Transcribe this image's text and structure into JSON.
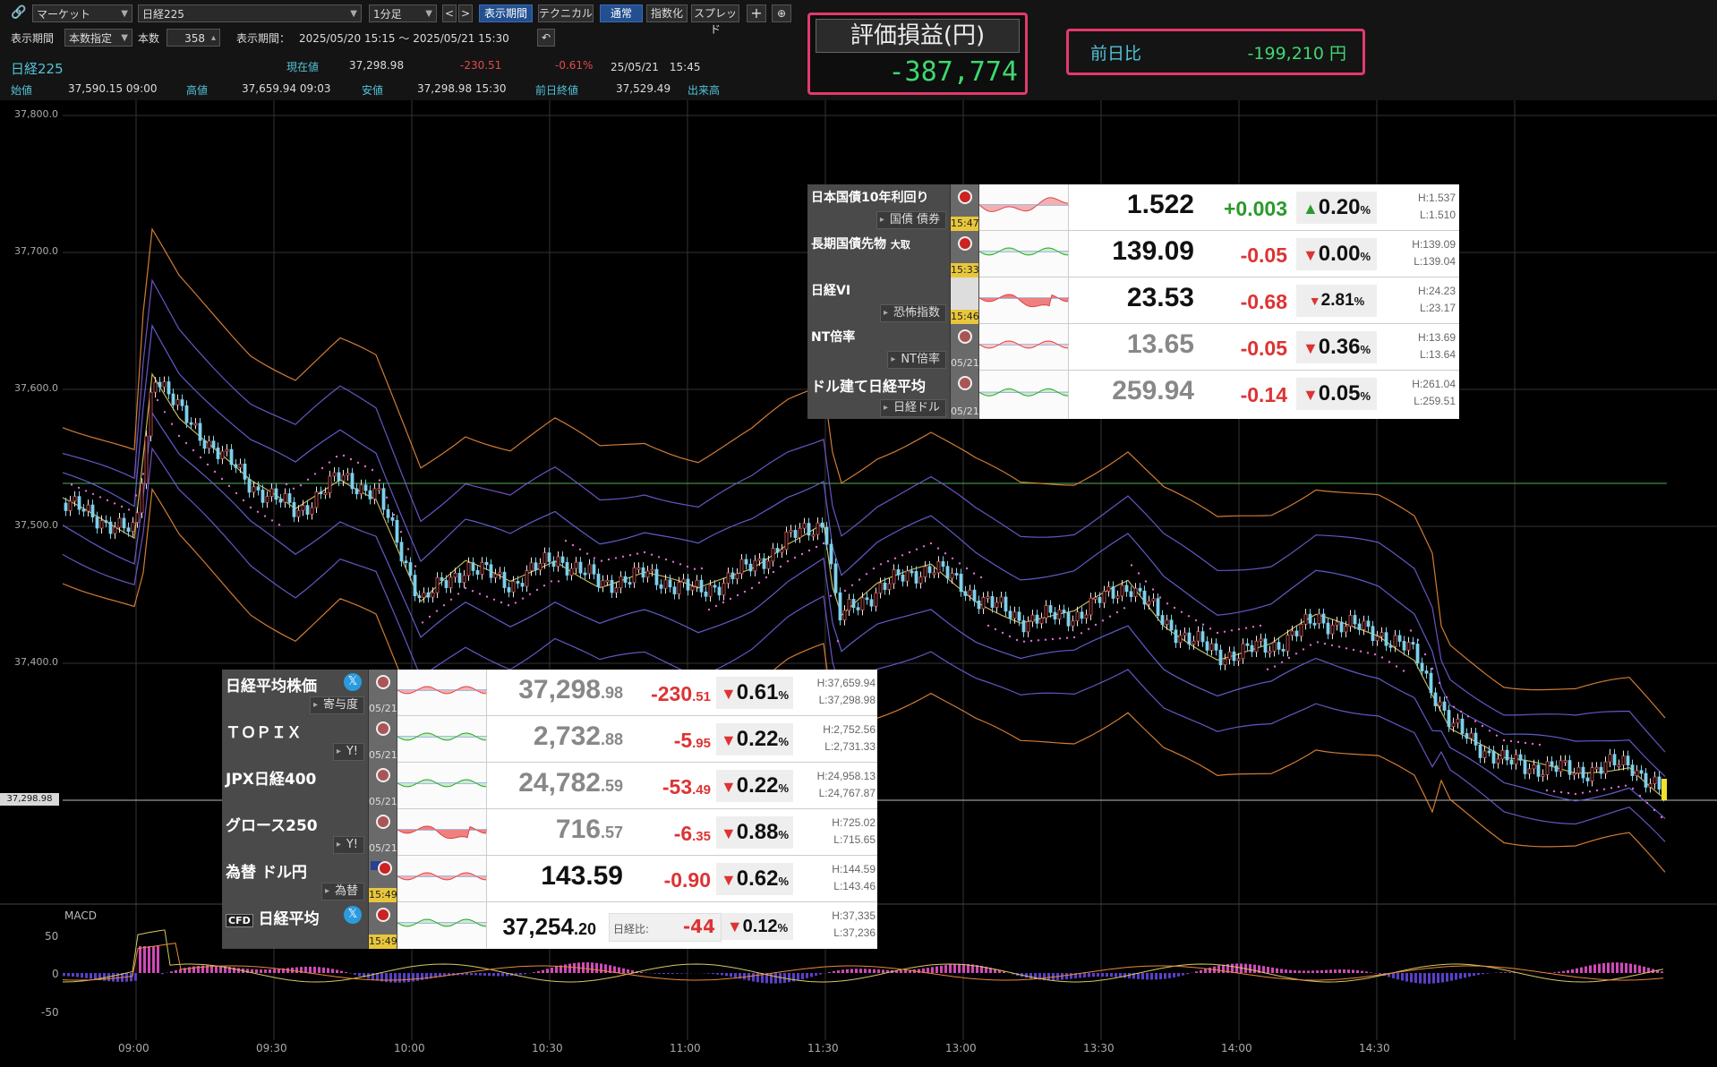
{
  "toolbar": {
    "market_select": "マーケット",
    "symbol_select": "日経225",
    "interval_select": "1分足",
    "prev_label": "<",
    "next_label": ">",
    "btn_period": "表示期間",
    "btn_technical": "テクニカル",
    "btn_normal": "通常",
    "btn_index": "指数化",
    "btn_spread": "スプレッド",
    "btn_plus": "+",
    "period_label": "表示期間",
    "period_mode": "本数指定",
    "count_label": "本数",
    "count_value": "358",
    "range_label": "表示期間：",
    "range_value": "2025/05/20 15:15 ～ 2025/05/21 15:30"
  },
  "quote": {
    "name": "日経225",
    "current_label": "現在値",
    "current_value": "37,298.98",
    "change_value": "-230.51",
    "change_pct": "-0.61%",
    "datetime": "25/05/21　15:45",
    "open_label": "始値",
    "open_value": "37,590.15  09:00",
    "high_label": "高値",
    "high_value": "37,659.94  09:03",
    "low_label": "安値",
    "low_value": "37,298.98  15:30",
    "prev_close_label": "前日終値",
    "prev_close_value": "37,529.49",
    "volume_label": "出来高"
  },
  "pl": {
    "title": "評価損益(円)",
    "value": "-387,774"
  },
  "dod": {
    "label": "前日比",
    "value": "-199,210 円"
  },
  "colors": {
    "accent_pink": "#e33a6d",
    "up_green": "#3ed870",
    "down_red": "#d33333",
    "cyan": "#53c2d8"
  },
  "chart": {
    "y_labels": [
      "37,800.0",
      "37,700.0",
      "37,600.0",
      "37,500.0",
      "37,400.0"
    ],
    "x_labels": [
      "09:00",
      "09:30",
      "10:00",
      "10:30",
      "11:00",
      "11:30",
      "13:00",
      "13:30",
      "14:00",
      "14:30"
    ],
    "last_price_tag": "37,298.98",
    "macd_title": "MACD",
    "macd_labels": [
      "50",
      "0",
      "-50"
    ]
  },
  "bonds_panel": {
    "rows": [
      {
        "name": "日本国債10年利回り",
        "sub": "国債 債券",
        "time": "15:47",
        "price": "1.522",
        "change": "+0.003",
        "arrow": "▲",
        "pct": "0.20",
        "pct_sign": "%",
        "high": "H:1.537",
        "low": "L:1.510"
      },
      {
        "name": "長期国債先物",
        "name_suffix": "大取",
        "sub": "",
        "time": "15:33",
        "price": "139.09",
        "change": "-0.05",
        "arrow": "▼",
        "pct": "0.00",
        "pct_sign": "%",
        "high": "H:139.09",
        "low": "L:139.04"
      },
      {
        "name": "日経VI",
        "sub": "恐怖指数",
        "time": "15:46",
        "price": "23.53",
        "change": "-0.68",
        "arrow": "▼",
        "pct": "2.81",
        "pct_sign": "%",
        "high": "H:24.23",
        "low": "L:23.17"
      },
      {
        "name": "NT倍率",
        "sub": "NT倍率",
        "time": "05/21",
        "price": "13.65",
        "change": "-0.05",
        "arrow": "▼",
        "pct": "0.36",
        "pct_sign": "%",
        "high": "H:13.69",
        "low": "L:13.64"
      },
      {
        "name": "ドル建て日経平均",
        "sub": "日経ドル",
        "time": "05/21",
        "price": "259.94",
        "change": "-0.14",
        "arrow": "▼",
        "pct": "0.05",
        "pct_sign": "%",
        "high": "H:261.04",
        "low": "L:259.51"
      }
    ]
  },
  "index_panel": {
    "rows": [
      {
        "name": "日経平均株価",
        "sub": "寄与度",
        "time": "05/21",
        "price_main": "37,298",
        "price_frac": ".98",
        "chg_main": "-230",
        "chg_frac": ".51",
        "arrow": "▼",
        "pct": "0.61",
        "pct_sign": "%",
        "high": "H:37,659.94",
        "low": "L:37,298.98"
      },
      {
        "name": "ＴＯＰＩＸ",
        "sub": "Y!",
        "time": "05/21",
        "price_main": "2,732",
        "price_frac": ".88",
        "chg_main": "-5",
        "chg_frac": ".95",
        "arrow": "▼",
        "pct": "0.22",
        "pct_sign": "%",
        "high": "H:2,752.56",
        "low": "L:2,731.33"
      },
      {
        "name": "JPX日経400",
        "sub": "",
        "time": "05/21",
        "price_main": "24,782",
        "price_frac": ".59",
        "chg_main": "-53",
        "chg_frac": ".49",
        "arrow": "▼",
        "pct": "0.22",
        "pct_sign": "%",
        "high": "H:24,958.13",
        "low": "L:24,767.87"
      },
      {
        "name": "グロース250",
        "sub": "Y!",
        "time": "05/21",
        "price_main": "716",
        "price_frac": ".57",
        "chg_main": "-6",
        "chg_frac": ".35",
        "arrow": "▼",
        "pct": "0.88",
        "pct_sign": "%",
        "high": "H:725.02",
        "low": "L:715.65"
      },
      {
        "name": "為替 ドル円",
        "sub": "為替",
        "time": "15:49",
        "price_main": "143.59",
        "price_frac": "",
        "chg_main": "-0.90",
        "chg_frac": "",
        "arrow": "▼",
        "pct": "0.62",
        "pct_sign": "%",
        "high": "H:144.59",
        "low": "L:143.46"
      },
      {
        "name": "日経平均",
        "prefix": "CFD",
        "sub": "",
        "time": "15:49",
        "price_main": "37,254",
        "price_frac": ".20",
        "diff_label": "日経比:",
        "chg_main": "-44",
        "chg_frac": "",
        "arrow": "▼",
        "pct": "0.12",
        "pct_sign": "%",
        "high": "H:37,335",
        "low": "L:37,236"
      }
    ]
  }
}
